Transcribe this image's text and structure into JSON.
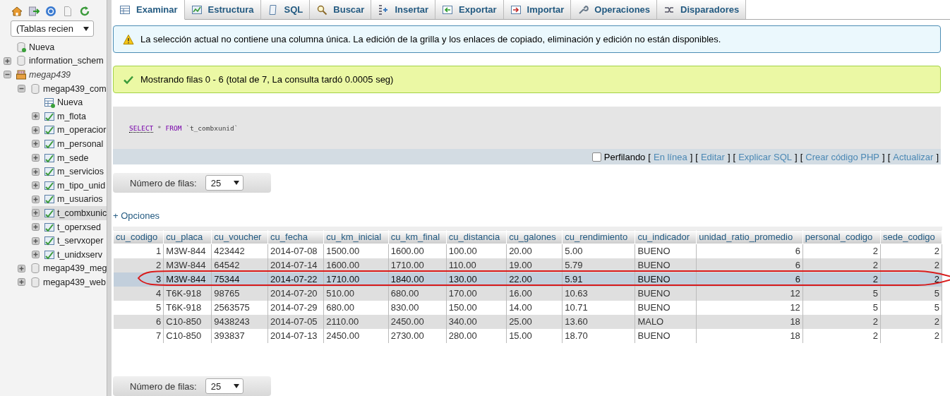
{
  "sidebar": {
    "recent_tables": {
      "value": "(Tablas recien"
    },
    "tree": [
      {
        "label": "Nueva",
        "kind": "new"
      },
      {
        "label": "information_schem",
        "kind": "db",
        "expanded": false
      },
      {
        "label": "megap439",
        "kind": "server",
        "expanded": true,
        "children": [
          {
            "label": "megap439_com",
            "kind": "db",
            "expanded": true,
            "children": [
              {
                "label": "Nueva",
                "kind": "new-table"
              },
              {
                "label": "m_flota",
                "kind": "table",
                "expanded": false,
                "selected": false
              },
              {
                "label": "m_operacior",
                "kind": "table",
                "expanded": false,
                "selected": false
              },
              {
                "label": "m_personal",
                "kind": "table",
                "expanded": false,
                "selected": false
              },
              {
                "label": "m_sede",
                "kind": "table",
                "expanded": false,
                "selected": false
              },
              {
                "label": "m_servicios",
                "kind": "table",
                "expanded": false,
                "selected": false
              },
              {
                "label": "m_tipo_unid",
                "kind": "table",
                "expanded": false,
                "selected": false
              },
              {
                "label": "m_usuarios",
                "kind": "table",
                "expanded": false,
                "selected": false
              },
              {
                "label": "t_combxunic",
                "kind": "table",
                "expanded": false,
                "selected": true
              },
              {
                "label": "t_operxsed",
                "kind": "table",
                "expanded": false,
                "selected": false
              },
              {
                "label": "t_servxoper",
                "kind": "table",
                "expanded": false,
                "selected": false
              },
              {
                "label": "t_unidxserv",
                "kind": "table",
                "expanded": false,
                "selected": false
              }
            ]
          },
          {
            "label": "megap439_meg",
            "kind": "db",
            "expanded": false
          },
          {
            "label": "megap439_web",
            "kind": "db",
            "expanded": false
          }
        ]
      }
    ]
  },
  "tabs": [
    {
      "label": "Examinar",
      "selected": true
    },
    {
      "label": "Estructura",
      "selected": false
    },
    {
      "label": "SQL",
      "selected": false
    },
    {
      "label": "Buscar",
      "selected": false
    },
    {
      "label": "Insertar",
      "selected": false
    },
    {
      "label": "Exportar",
      "selected": false
    },
    {
      "label": "Importar",
      "selected": false
    },
    {
      "label": "Operaciones",
      "selected": false
    },
    {
      "label": "Disparadores",
      "selected": false
    }
  ],
  "notice": {
    "text": "La selección actual no contiene una columna única. La edición de la grilla y los enlaces de copiado, eliminación y edición no están disponibles."
  },
  "success": {
    "text": "Mostrando filas 0 - 6 (total de 7, La consulta tardó 0.0005 seg)"
  },
  "sql": {
    "query": [
      {
        "kind": "keyword",
        "text": "SELECT"
      },
      {
        "kind": "operator",
        "text": "*"
      },
      {
        "kind": "keyword",
        "text": "FROM"
      },
      {
        "kind": "identifier",
        "text": "`t_combxunid`"
      }
    ]
  },
  "profiling": {
    "label": "Perfilando",
    "checked": false,
    "bracket_open": "[",
    "bracket_close": "]",
    "links": [
      "En línea",
      "Editar",
      "Explicar SQL",
      "Crear código PHP",
      "Actualizar"
    ]
  },
  "rows_selector_top": {
    "label": "Número de filas:",
    "value": "25"
  },
  "options_link": "+ Opciones",
  "table": {
    "columns": [
      {
        "label": "cu_codigo",
        "kind": "number"
      },
      {
        "label": "cu_placa",
        "kind": "text"
      },
      {
        "label": "cu_voucher",
        "kind": "text"
      },
      {
        "label": "cu_fecha",
        "kind": "text"
      },
      {
        "label": "cu_km_inicial",
        "kind": "text"
      },
      {
        "label": "cu_km_final",
        "kind": "text"
      },
      {
        "label": "cu_distancia",
        "kind": "text"
      },
      {
        "label": "cu_galones",
        "kind": "text"
      },
      {
        "label": "cu_rendimiento",
        "kind": "text"
      },
      {
        "label": "cu_indicador",
        "kind": "text"
      },
      {
        "label": "unidad_ratio_promedio",
        "kind": "number"
      },
      {
        "label": "personal_codigo",
        "kind": "number"
      },
      {
        "label": "sede_codigo",
        "kind": "number"
      }
    ],
    "rows": [
      {
        "selected": false,
        "cells": [
          "1",
          "M3W-844",
          "423442",
          "2014-07-08",
          "1500.00",
          "1600.00",
          "100.00",
          "20.00",
          "5.00",
          "BUENO",
          "6",
          "2",
          "2"
        ]
      },
      {
        "selected": false,
        "cells": [
          "2",
          "M3W-844",
          "64542",
          "2014-07-14",
          "1600.00",
          "1710.00",
          "110.00",
          "19.00",
          "5.79",
          "BUENO",
          "6",
          "2",
          "2"
        ]
      },
      {
        "selected": true,
        "cells": [
          "3",
          "M3W-844",
          "75344",
          "2014-07-22",
          "1710.00",
          "1840.00",
          "130.00",
          "22.00",
          "5.91",
          "BUENO",
          "6",
          "2",
          "2"
        ]
      },
      {
        "selected": false,
        "cells": [
          "4",
          "T6K-918",
          "98765",
          "2014-07-20",
          "510.00",
          "680.00",
          "170.00",
          "16.00",
          "10.63",
          "BUENO",
          "12",
          "5",
          "5"
        ]
      },
      {
        "selected": false,
        "cells": [
          "5",
          "T6K-918",
          "2563575",
          "2014-07-29",
          "680.00",
          "830.00",
          "150.00",
          "14.00",
          "10.71",
          "BUENO",
          "12",
          "5",
          "5"
        ]
      },
      {
        "selected": false,
        "cells": [
          "6",
          "C10-850",
          "9438243",
          "2014-07-05",
          "2110.00",
          "2450.00",
          "340.00",
          "25.00",
          "13.60",
          "MALO",
          "18",
          "2",
          "2"
        ]
      },
      {
        "selected": false,
        "cells": [
          "7",
          "C10-850",
          "393837",
          "2014-07-13",
          "2450.00",
          "2730.00",
          "280.00",
          "15.00",
          "18.70",
          "BUENO",
          "18",
          "2",
          "2"
        ]
      }
    ]
  },
  "rows_selector_bottom": {
    "label": "Número de filas:",
    "value": "25"
  }
}
